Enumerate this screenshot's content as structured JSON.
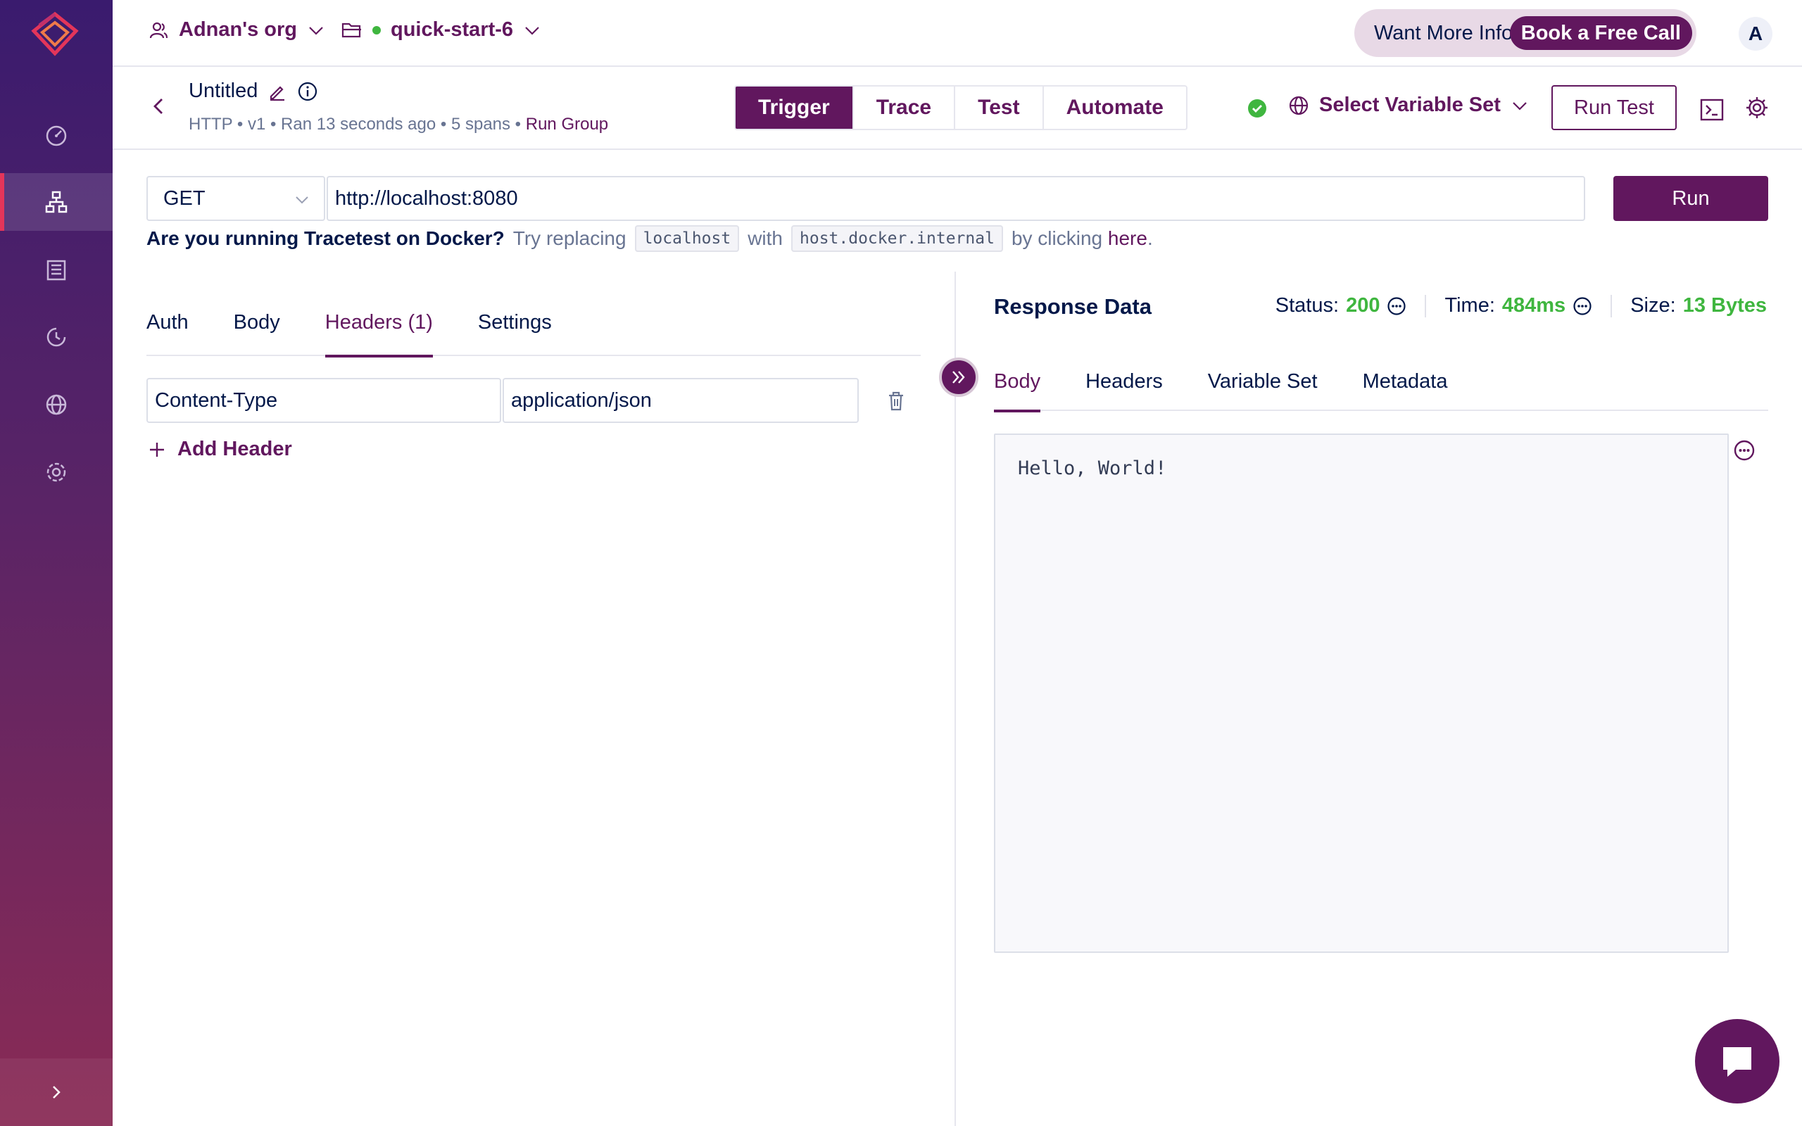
{
  "topbar": {
    "org_name": "Adnan's org",
    "project_name": "quick-start-6",
    "info_prompt": "Want More Info?",
    "book_call": "Book a Free Call",
    "avatar_initial": "A"
  },
  "test": {
    "title": "Untitled",
    "meta_prefix": "HTTP • v1 • Ran 13 seconds ago • 5 spans • ",
    "run_group": "Run Group",
    "modes": [
      "Trigger",
      "Trace",
      "Test",
      "Automate"
    ],
    "active_mode": "Trigger",
    "variable_set_label": "Select Variable Set",
    "run_test_label": "Run Test"
  },
  "request": {
    "method": "GET",
    "url": "http://localhost:8080",
    "run_label": "Run"
  },
  "docker_hint": {
    "question": "Are you running Tracetest on Docker?",
    "try": "Try replacing",
    "from": "localhost",
    "with": "with",
    "to": "host.docker.internal",
    "by": "by clicking",
    "here": "here",
    "period": "."
  },
  "left_tabs": [
    "Auth",
    "Body",
    "Headers (1)",
    "Settings"
  ],
  "headers": [
    {
      "key": "Content-Type",
      "value": "application/json"
    }
  ],
  "add_header_label": "Add Header",
  "response": {
    "title": "Response Data",
    "status_label": "Status:",
    "status_value": "200",
    "time_label": "Time:",
    "time_value": "484ms",
    "size_label": "Size:",
    "size_value": "13 Bytes",
    "tabs": [
      "Body",
      "Headers",
      "Variable Set",
      "Metadata"
    ],
    "body": "Hello, World!"
  },
  "colors": {
    "brand": "#61175e",
    "success": "#3fb63f",
    "text": "#031849",
    "accent_red": "#e4355a"
  },
  "icons": {
    "sidebar": [
      "dashboard-icon",
      "tests-icon",
      "test-suites-icon",
      "runs-history-icon",
      "environments-icon",
      "settings-icon"
    ]
  }
}
